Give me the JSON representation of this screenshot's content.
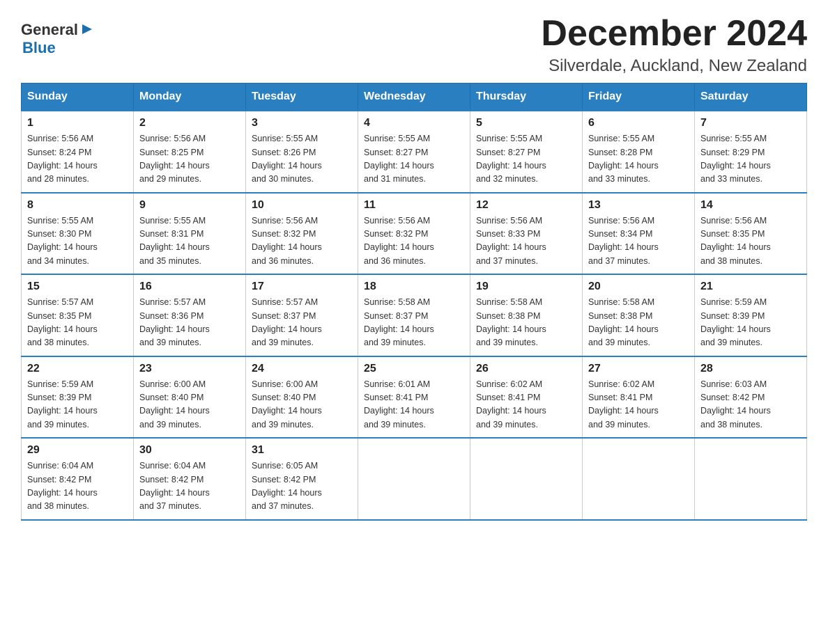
{
  "logo": {
    "text_general": "General",
    "text_blue": "Blue",
    "triangle_unicode": "▶"
  },
  "header": {
    "title": "December 2024",
    "subtitle": "Silverdale, Auckland, New Zealand"
  },
  "days_of_week": [
    "Sunday",
    "Monday",
    "Tuesday",
    "Wednesday",
    "Thursday",
    "Friday",
    "Saturday"
  ],
  "weeks": [
    [
      {
        "day": "1",
        "sunrise": "5:56 AM",
        "sunset": "8:24 PM",
        "daylight": "14 hours and 28 minutes."
      },
      {
        "day": "2",
        "sunrise": "5:56 AM",
        "sunset": "8:25 PM",
        "daylight": "14 hours and 29 minutes."
      },
      {
        "day": "3",
        "sunrise": "5:55 AM",
        "sunset": "8:26 PM",
        "daylight": "14 hours and 30 minutes."
      },
      {
        "day": "4",
        "sunrise": "5:55 AM",
        "sunset": "8:27 PM",
        "daylight": "14 hours and 31 minutes."
      },
      {
        "day": "5",
        "sunrise": "5:55 AM",
        "sunset": "8:27 PM",
        "daylight": "14 hours and 32 minutes."
      },
      {
        "day": "6",
        "sunrise": "5:55 AM",
        "sunset": "8:28 PM",
        "daylight": "14 hours and 33 minutes."
      },
      {
        "day": "7",
        "sunrise": "5:55 AM",
        "sunset": "8:29 PM",
        "daylight": "14 hours and 33 minutes."
      }
    ],
    [
      {
        "day": "8",
        "sunrise": "5:55 AM",
        "sunset": "8:30 PM",
        "daylight": "14 hours and 34 minutes."
      },
      {
        "day": "9",
        "sunrise": "5:55 AM",
        "sunset": "8:31 PM",
        "daylight": "14 hours and 35 minutes."
      },
      {
        "day": "10",
        "sunrise": "5:56 AM",
        "sunset": "8:32 PM",
        "daylight": "14 hours and 36 minutes."
      },
      {
        "day": "11",
        "sunrise": "5:56 AM",
        "sunset": "8:32 PM",
        "daylight": "14 hours and 36 minutes."
      },
      {
        "day": "12",
        "sunrise": "5:56 AM",
        "sunset": "8:33 PM",
        "daylight": "14 hours and 37 minutes."
      },
      {
        "day": "13",
        "sunrise": "5:56 AM",
        "sunset": "8:34 PM",
        "daylight": "14 hours and 37 minutes."
      },
      {
        "day": "14",
        "sunrise": "5:56 AM",
        "sunset": "8:35 PM",
        "daylight": "14 hours and 38 minutes."
      }
    ],
    [
      {
        "day": "15",
        "sunrise": "5:57 AM",
        "sunset": "8:35 PM",
        "daylight": "14 hours and 38 minutes."
      },
      {
        "day": "16",
        "sunrise": "5:57 AM",
        "sunset": "8:36 PM",
        "daylight": "14 hours and 39 minutes."
      },
      {
        "day": "17",
        "sunrise": "5:57 AM",
        "sunset": "8:37 PM",
        "daylight": "14 hours and 39 minutes."
      },
      {
        "day": "18",
        "sunrise": "5:58 AM",
        "sunset": "8:37 PM",
        "daylight": "14 hours and 39 minutes."
      },
      {
        "day": "19",
        "sunrise": "5:58 AM",
        "sunset": "8:38 PM",
        "daylight": "14 hours and 39 minutes."
      },
      {
        "day": "20",
        "sunrise": "5:58 AM",
        "sunset": "8:38 PM",
        "daylight": "14 hours and 39 minutes."
      },
      {
        "day": "21",
        "sunrise": "5:59 AM",
        "sunset": "8:39 PM",
        "daylight": "14 hours and 39 minutes."
      }
    ],
    [
      {
        "day": "22",
        "sunrise": "5:59 AM",
        "sunset": "8:39 PM",
        "daylight": "14 hours and 39 minutes."
      },
      {
        "day": "23",
        "sunrise": "6:00 AM",
        "sunset": "8:40 PM",
        "daylight": "14 hours and 39 minutes."
      },
      {
        "day": "24",
        "sunrise": "6:00 AM",
        "sunset": "8:40 PM",
        "daylight": "14 hours and 39 minutes."
      },
      {
        "day": "25",
        "sunrise": "6:01 AM",
        "sunset": "8:41 PM",
        "daylight": "14 hours and 39 minutes."
      },
      {
        "day": "26",
        "sunrise": "6:02 AM",
        "sunset": "8:41 PM",
        "daylight": "14 hours and 39 minutes."
      },
      {
        "day": "27",
        "sunrise": "6:02 AM",
        "sunset": "8:41 PM",
        "daylight": "14 hours and 39 minutes."
      },
      {
        "day": "28",
        "sunrise": "6:03 AM",
        "sunset": "8:42 PM",
        "daylight": "14 hours and 38 minutes."
      }
    ],
    [
      {
        "day": "29",
        "sunrise": "6:04 AM",
        "sunset": "8:42 PM",
        "daylight": "14 hours and 38 minutes."
      },
      {
        "day": "30",
        "sunrise": "6:04 AM",
        "sunset": "8:42 PM",
        "daylight": "14 hours and 37 minutes."
      },
      {
        "day": "31",
        "sunrise": "6:05 AM",
        "sunset": "8:42 PM",
        "daylight": "14 hours and 37 minutes."
      },
      null,
      null,
      null,
      null
    ]
  ],
  "labels": {
    "sunrise": "Sunrise:",
    "sunset": "Sunset:",
    "daylight": "Daylight:"
  }
}
